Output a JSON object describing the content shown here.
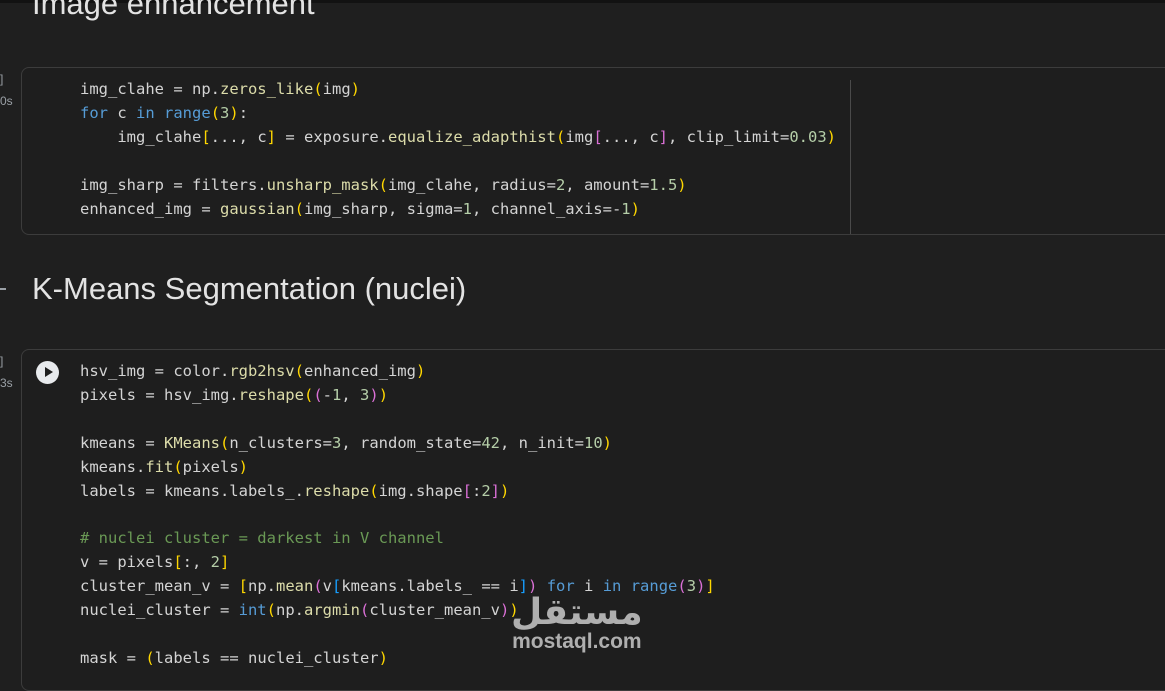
{
  "sections": [
    {
      "heading": "Image enhancement"
    },
    {
      "heading": "K-Means Segmentation (nuclei)"
    }
  ],
  "gutter": {
    "cell1_bracket": "]",
    "cell1_time": "0s",
    "cell2_bracket": "]",
    "cell2_time": "3s"
  },
  "cell1": {
    "lines": [
      "img_clahe = np.zeros_like(img)",
      "for c in range(3):",
      "    img_clahe[..., c] = exposure.equalize_adapthist(img[..., c], clip_limit=0.03)",
      "",
      "img_sharp = filters.unsharp_mask(img_clahe, radius=2, amount=1.5)",
      "enhanced_img = gaussian(img_sharp, sigma=1, channel_axis=-1)"
    ]
  },
  "cell2": {
    "run_icon": "play-icon",
    "lines": [
      "hsv_img = color.rgb2hsv(enhanced_img)",
      "pixels = hsv_img.reshape((-1, 3))",
      "",
      "kmeans = KMeans(n_clusters=3, random_state=42, n_init=10)",
      "kmeans.fit(pixels)",
      "labels = kmeans.labels_.reshape(img.shape[:2])",
      "",
      "# nuclei cluster = darkest in V channel",
      "v = pixels[:, 2]",
      "cluster_mean_v = [np.mean(v[kmeans.labels_ == i]) for i in range(3)]",
      "nuclei_cluster = int(np.argmin(cluster_mean_v))",
      "",
      "mask = (labels == nuclei_cluster)"
    ]
  },
  "watermark": {
    "arabic": "مستقل",
    "latin": "mostaql.com"
  },
  "colors": {
    "background": "#1f1f1f",
    "keyword": "#569cd6",
    "function": "#dcdcaa",
    "number": "#b5cea8",
    "comment": "#6a9955",
    "bracket1": "#ffd700",
    "bracket2": "#da70d6",
    "bracket3": "#179fff"
  }
}
